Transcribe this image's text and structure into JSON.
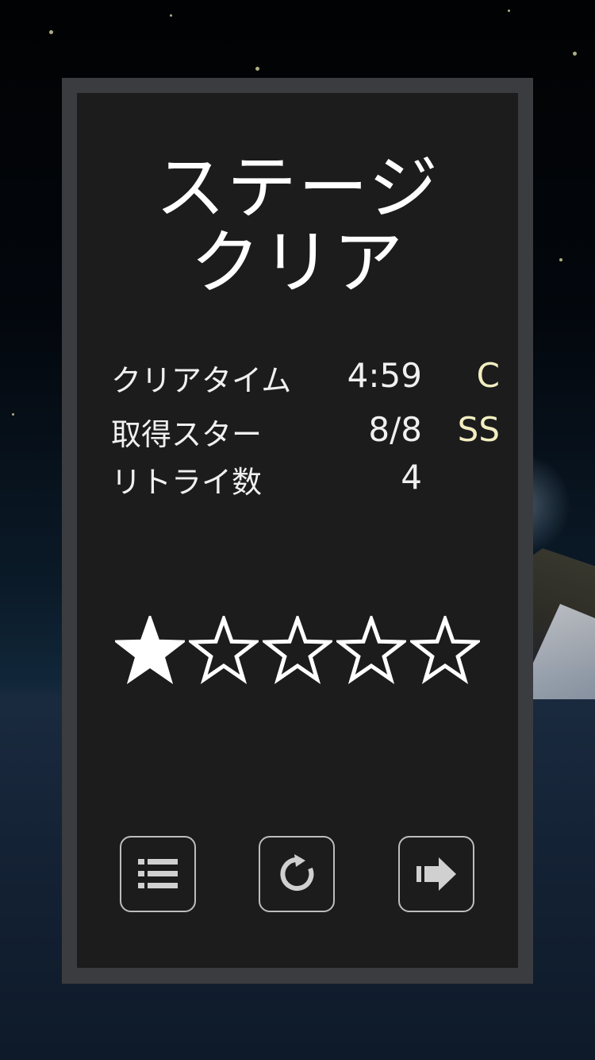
{
  "screen": {
    "title_line1": "ステージ",
    "title_line2": "クリア"
  },
  "stats": [
    {
      "label": "クリアタイム",
      "value": "4:59",
      "rank": "C"
    },
    {
      "label": "取得スター",
      "value": "8/8",
      "rank": "SS"
    },
    {
      "label": "リトライ数",
      "value": "4",
      "rank": ""
    }
  ],
  "rating": {
    "filled": 1,
    "total": 5
  },
  "buttons": {
    "menu_icon": "list-icon",
    "retry_icon": "retry-icon",
    "next_icon": "arrow-right-icon"
  },
  "colors": {
    "panel_border": "#3b3c3f",
    "panel_fill": "#1c1c1d",
    "rank_text": "#f2eec0",
    "star": "#ffffff"
  }
}
